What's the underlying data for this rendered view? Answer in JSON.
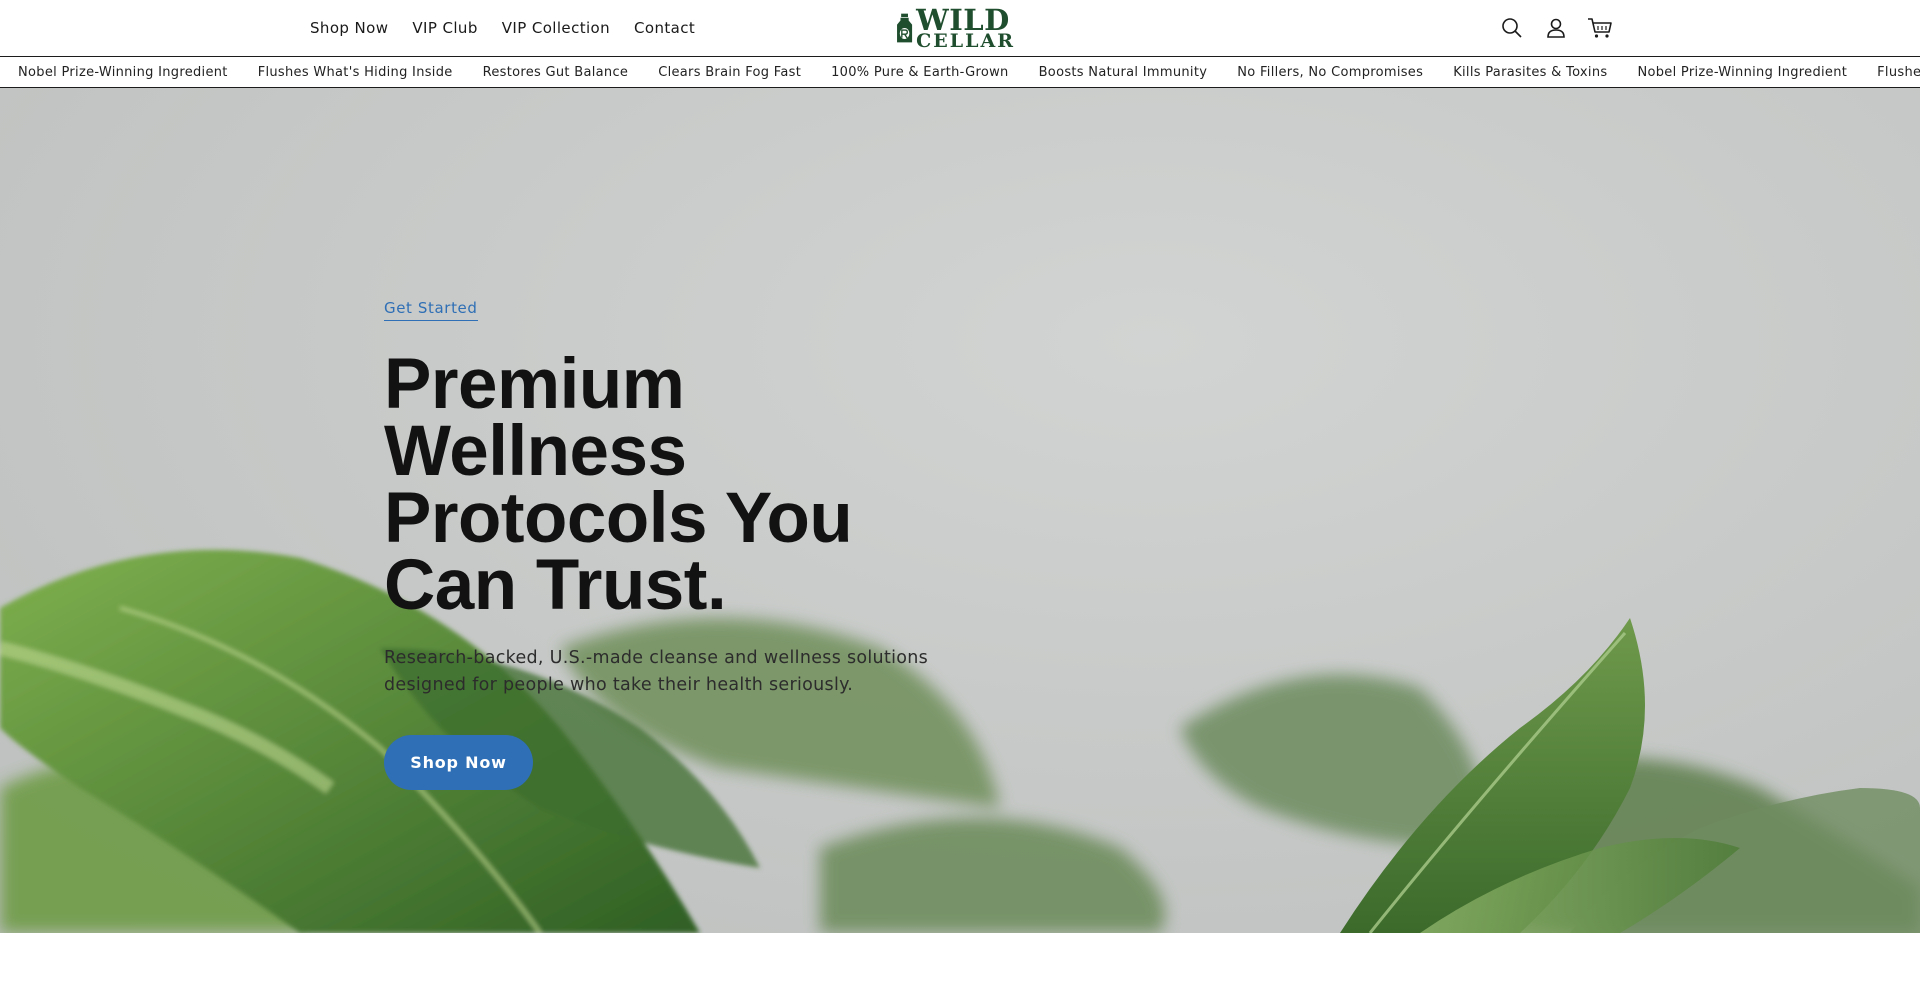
{
  "header": {
    "nav": [
      {
        "label": "Shop Now"
      },
      {
        "label": "VIP Club"
      },
      {
        "label": "VIP Collection"
      },
      {
        "label": "Contact"
      }
    ],
    "logo": {
      "line1": "WILD",
      "line2": "CELLAR"
    },
    "icons": [
      "search-icon",
      "account-icon",
      "cart-icon"
    ]
  },
  "ticker": {
    "items": [
      "Nobel Prize-Winning Ingredient",
      "Flushes What's Hiding Inside",
      "Restores Gut Balance",
      "Clears Brain Fog Fast",
      "100% Pure & Earth-Grown",
      "Boosts Natural Immunity",
      "No Fillers, No Compromises",
      "Kills Parasites & Toxins",
      "Nobel Prize-Winning Ingredient",
      "Flushes What's Hiding Inside"
    ]
  },
  "hero": {
    "eyebrow": "Get Started",
    "headline": "Premium Wellness Protocols You Can Trust.",
    "subheading": "Research-backed, U.S.-made cleanse and wellness solutions designed for people who take their health seriously.",
    "cta_label": "Shop Now"
  },
  "colors": {
    "accent": "#2f6fb5",
    "logo_green": "#1f4e2e",
    "text": "#121212",
    "hero_bg": "#c8cac9",
    "leaf_green": "#4f8a3a"
  }
}
